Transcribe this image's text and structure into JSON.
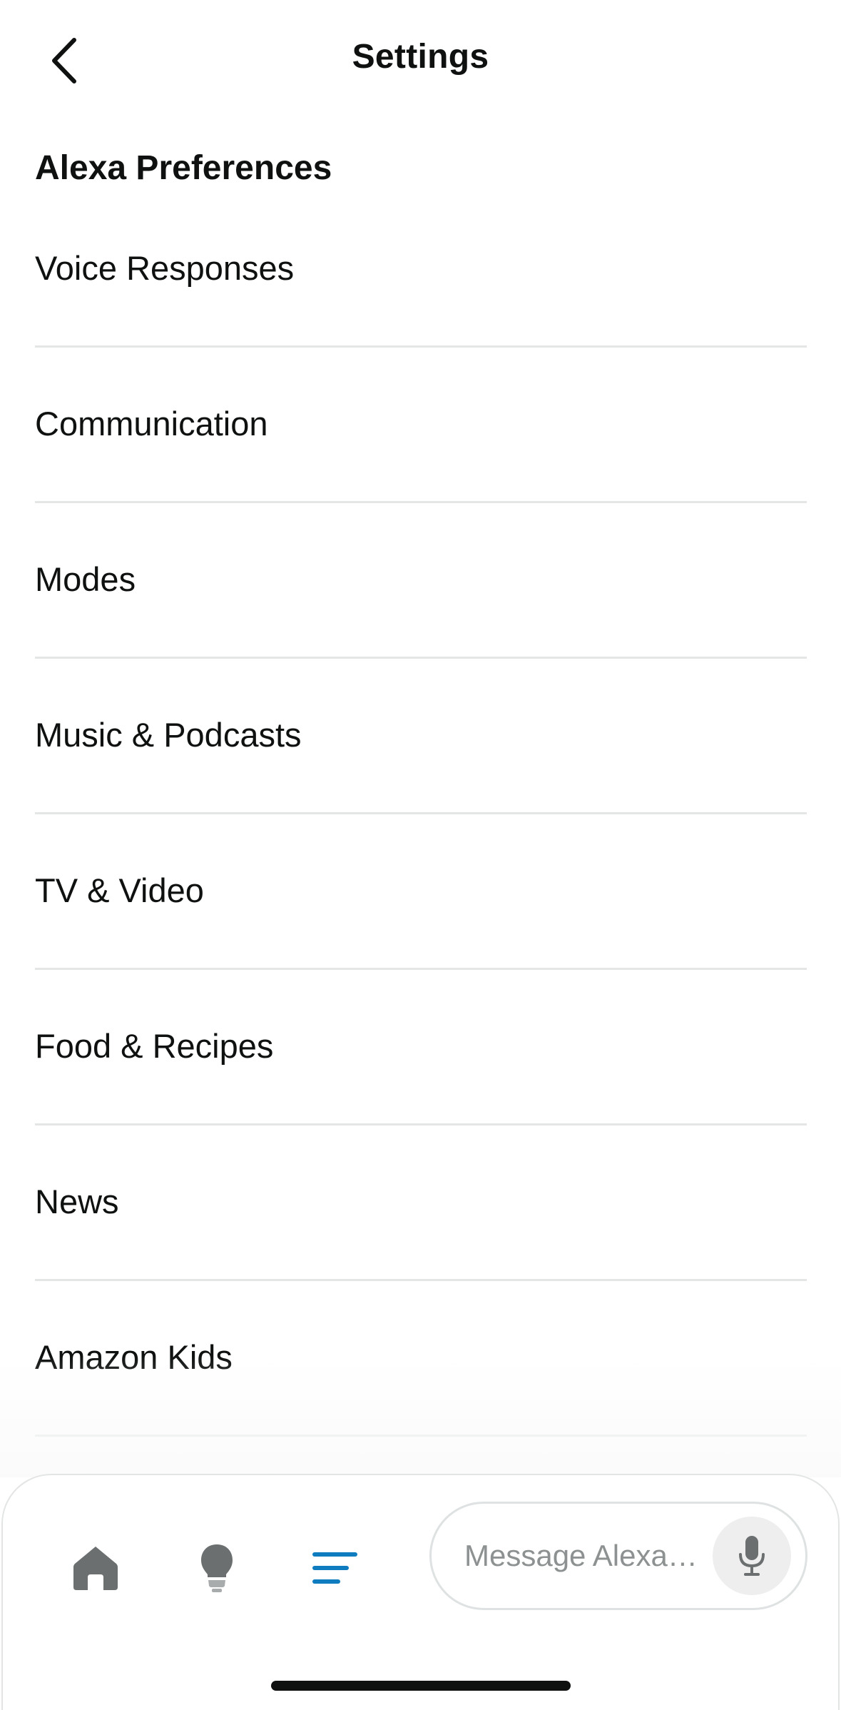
{
  "header": {
    "title": "Settings",
    "back_icon": "chevron-left-icon"
  },
  "section": {
    "heading": "Alexa Preferences"
  },
  "items": [
    {
      "label": "Voice Responses"
    },
    {
      "label": "Communication"
    },
    {
      "label": "Modes"
    },
    {
      "label": "Music & Podcasts"
    },
    {
      "label": "TV & Video"
    },
    {
      "label": "Food & Recipes"
    },
    {
      "label": "News"
    },
    {
      "label": "Amazon Kids"
    }
  ],
  "bottom_nav": {
    "home_icon": "home-icon",
    "bulb_icon": "lightbulb-icon",
    "more_icon": "menu-lines-icon",
    "active_color": "#0f7cc0",
    "inactive_color": "#6b6f70",
    "message_placeholder": "Message Alexa…",
    "mic_icon": "microphone-icon"
  }
}
